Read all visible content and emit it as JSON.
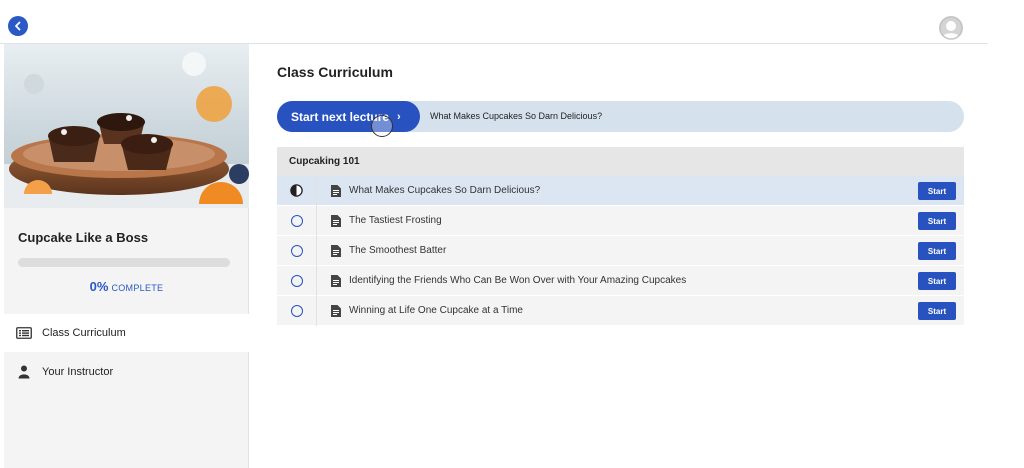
{
  "course": {
    "title": "Cupcake Like a Boss",
    "progress_percent": 0,
    "progress_value": "0%",
    "progress_label": "COMPLETE"
  },
  "sidebar": {
    "items": [
      {
        "label": "Class Curriculum",
        "icon": "list-icon",
        "active": true
      },
      {
        "label": "Your Instructor",
        "icon": "user-icon",
        "active": false
      }
    ]
  },
  "main": {
    "title": "Class Curriculum",
    "next_lecture": {
      "button_label": "Start next lecture",
      "lecture_title": "What Makes Cupcakes So Darn Delicious?"
    },
    "sections": [
      {
        "title": "Cupcaking 101",
        "lectures": [
          {
            "title": "What Makes Cupcakes So Darn Delicious?",
            "status": "in-progress",
            "action": "Start"
          },
          {
            "title": "The Tastiest Frosting",
            "status": "not-started",
            "action": "Start"
          },
          {
            "title": "The Smoothest Batter",
            "status": "not-started",
            "action": "Start"
          },
          {
            "title": "Identifying the Friends Who Can Be Won Over with Your Amazing Cupcakes",
            "status": "not-started",
            "action": "Start"
          },
          {
            "title": "Winning at Life One Cupcake at a Time",
            "status": "not-started",
            "action": "Start"
          }
        ]
      }
    ]
  },
  "colors": {
    "accent": "#2752bf",
    "next_bar_bg": "#d6e1ee",
    "current_row_bg": "#dce6f3"
  }
}
